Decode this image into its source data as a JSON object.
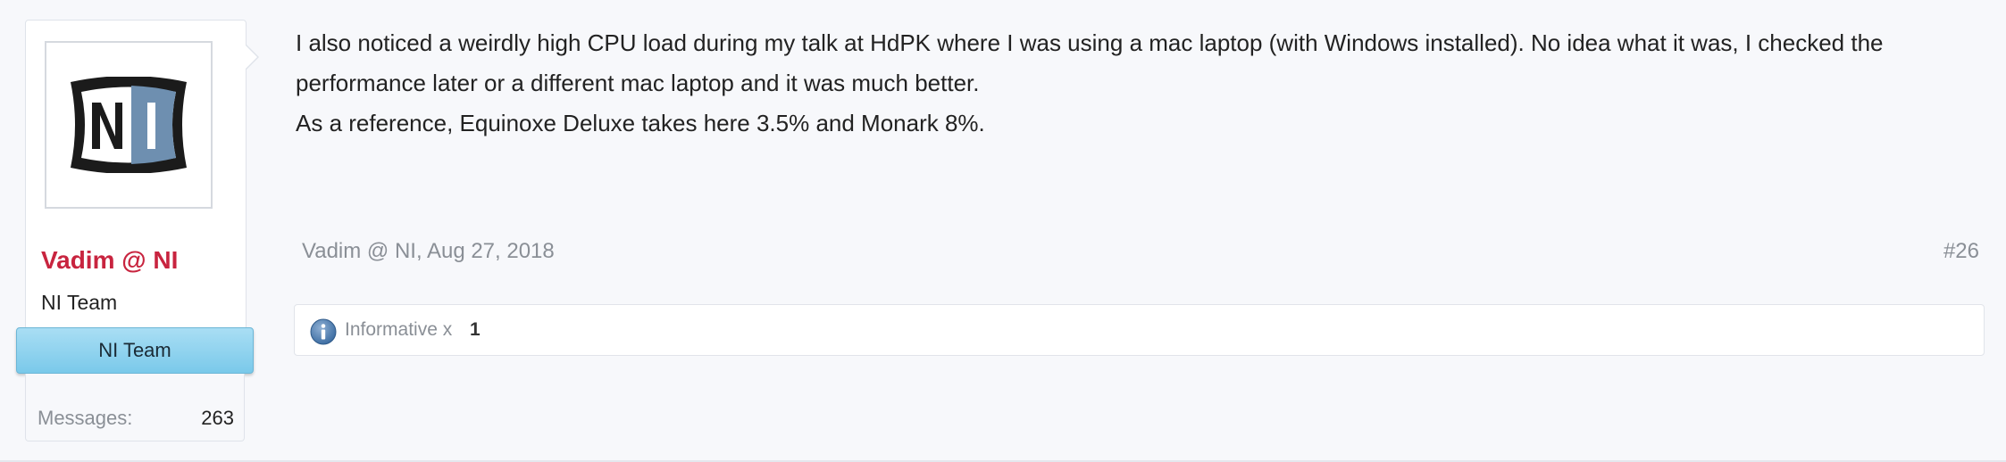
{
  "user": {
    "avatar_icon": "ni-logo-icon",
    "name": "Vadim @ NI",
    "title": "NI Team",
    "banner": "NI Team",
    "stats": {
      "label": "Messages:",
      "value": "263"
    }
  },
  "post": {
    "paragraphs": [
      "I also noticed a weirdly high CPU load during my talk at HdPK where I was using a mac laptop (with Windows installed). No idea what it was, I checked the performance later or a different mac laptop and it was much better.",
      "As a reference, Equinoxe Deluxe takes here 3.5% and Monark 8%."
    ],
    "author_date": "Vadim @ NI, Aug 27, 2018",
    "post_number": "#26",
    "rating": {
      "icon": "info-icon",
      "label": "Informative x",
      "count": "1"
    }
  },
  "colors": {
    "username": "#c8243f",
    "banner": "#8fd2ee",
    "logo_blue": "#6e8fb0"
  }
}
